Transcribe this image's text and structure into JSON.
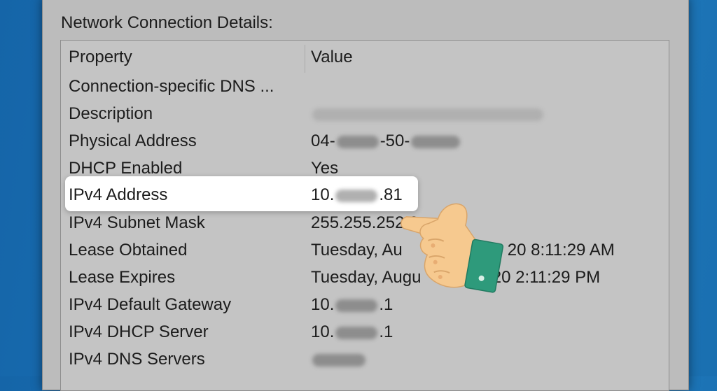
{
  "section_title": "Network Connection Details:",
  "columns": {
    "property": "Property",
    "value": "Value"
  },
  "rows": [
    {
      "property": "Connection-specific DNS ...",
      "value": ""
    },
    {
      "property": "Description",
      "value": ""
    },
    {
      "property": "Physical Address",
      "value_prefix": "04-",
      "value_mid": "-50-",
      "value_suffix": ""
    },
    {
      "property": "DHCP Enabled",
      "value": "Yes"
    },
    {
      "property": "IPv4 Address",
      "value_prefix": "10.",
      "value_suffix": ".81"
    },
    {
      "property": "IPv4 Subnet Mask",
      "value": "255.255.252.0"
    },
    {
      "property": "Lease Obtained",
      "value_prefix": "Tuesday, Au",
      "value_suffix": "20 8:11:29 AM"
    },
    {
      "property": "Lease Expires",
      "value_prefix": "Tuesday, Augu",
      "value_suffix": "020 2:11:29 PM"
    },
    {
      "property": "IPv4 Default Gateway",
      "value_prefix": "10.",
      "value_suffix": ".1"
    },
    {
      "property": "IPv4 DHCP Server",
      "value_prefix": "10.",
      "value_suffix": ".1"
    },
    {
      "property": "IPv4 DNS Servers",
      "value": ""
    }
  ],
  "selected_row": "IPv4 Address",
  "colors": {
    "background": "#1a70b5",
    "dialog": "#bcbcbc",
    "highlight": "#ffffff",
    "hand_skin": "#f6c98f",
    "hand_cuff": "#2e9a7b"
  },
  "icons": {
    "pointer": "pointing-hand-icon"
  }
}
